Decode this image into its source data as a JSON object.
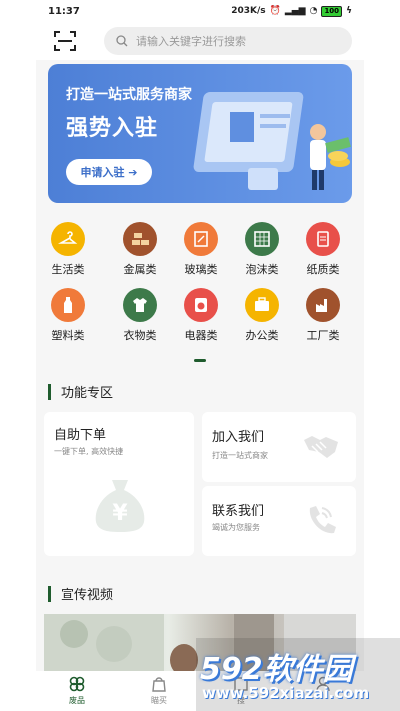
{
  "status": {
    "time": "11:37",
    "speed": "203K/s",
    "battery": "100"
  },
  "search": {
    "placeholder": "请输入关键字进行搜索"
  },
  "banner": {
    "line1": "打造一站式服务商家",
    "line2": "强势入驻",
    "button": "申请入驻"
  },
  "categories": [
    {
      "label": "生活类",
      "color": "#f5b400",
      "icon": "hanger-icon"
    },
    {
      "label": "金属类",
      "color": "#a0522d",
      "icon": "ingot-icon"
    },
    {
      "label": "玻璃类",
      "color": "#f07a3a",
      "icon": "glass-icon"
    },
    {
      "label": "泡沫类",
      "color": "#3d7a4a",
      "icon": "foam-icon"
    },
    {
      "label": "纸质类",
      "color": "#e8504a",
      "icon": "paper-icon"
    },
    {
      "label": "塑料类",
      "color": "#f07a3a",
      "icon": "bottle-icon"
    },
    {
      "label": "衣物类",
      "color": "#3d7a4a",
      "icon": "shirt-icon"
    },
    {
      "label": "电器类",
      "color": "#e8504a",
      "icon": "washer-icon"
    },
    {
      "label": "办公类",
      "color": "#f5b400",
      "icon": "briefcase-icon"
    },
    {
      "label": "工厂类",
      "color": "#a0522d",
      "icon": "factory-icon"
    }
  ],
  "features": {
    "title": "功能专区",
    "order": {
      "title": "自助下单",
      "sub": "一键下单, 高效快捷"
    },
    "join": {
      "title": "加入我们",
      "sub": "打造一站式商家"
    },
    "contact": {
      "title": "联系我们",
      "sub": "竭诚为您服务"
    }
  },
  "video": {
    "title": "宣传视频"
  },
  "tabs": [
    {
      "label": "废品",
      "icon": "clover-icon"
    },
    {
      "label": "瞄买",
      "icon": "bag-icon"
    },
    {
      "label": "搜",
      "icon": "grid-icon"
    },
    {
      "label": "",
      "icon": "user-icon"
    }
  ],
  "watermark": {
    "logo": "592软件园",
    "url": "www.592xiazai.com"
  },
  "colors": {
    "accent": "#1f5c2e",
    "banner": "#4d7fd6"
  }
}
